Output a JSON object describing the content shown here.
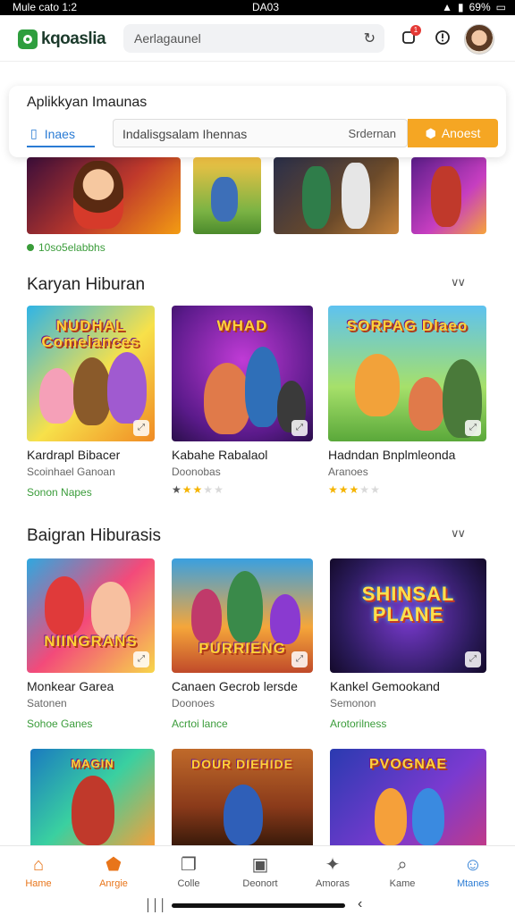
{
  "status_bar": {
    "left": "Mule cato  1:2",
    "center": "DA03",
    "right": "69%"
  },
  "header": {
    "logo_text": "kqoaslia",
    "search_value": "Aerlagaunel",
    "refresh_icon": "refresh-icon",
    "notification_count": "1",
    "accent": "#2e9e3e"
  },
  "popup": {
    "title": "Aplikkyan Imaunas",
    "tab_label": "Inaes",
    "field_value": "Indalisgsalam Ihennas",
    "field_suffix": "Srdernan",
    "button_label": "Anoest",
    "button_color": "#f5a623"
  },
  "strip": {
    "caption": "10so5elabbhs"
  },
  "sections": [
    {
      "title": "Karyan Hiburan",
      "cards": [
        {
          "art_text": "NUDHAL Comelances",
          "name": "Kardrapl Bibacer",
          "sub": "Scoinhael Ganoan",
          "tag": "Sonon Napes",
          "rating": null
        },
        {
          "art_text": "WHAD",
          "name": "Kabahe Rabalaol",
          "sub": "Doonobas",
          "tag": null,
          "rating": 3
        },
        {
          "art_text": "SORPAG Dlaeo",
          "name": "Hadndan Bnplmleonda",
          "sub": "Aranoes",
          "tag": null,
          "rating": 3
        }
      ]
    },
    {
      "title": "Baigran Hiburasis",
      "cards": [
        {
          "art_text": "NIINGRANS",
          "name": "Monkear Garea",
          "sub": "Satonen",
          "tag": "Sohoe Ganes",
          "rating": null
        },
        {
          "art_text": "PURRIENG",
          "name": "Canaen Gecrob  lersde",
          "sub": "Doonoes",
          "tag": "Acrtoi lance",
          "rating": null
        },
        {
          "art_text": "SHINSAL PLANE",
          "name": "Kankel Gemookand",
          "sub": "Semonon",
          "tag": "Arotorilness",
          "rating": null
        }
      ]
    }
  ],
  "bottom_row_art": [
    {
      "art_text": "MAGIN"
    },
    {
      "art_text": "DOUR DIEHIDE"
    },
    {
      "art_text": "PVOGNAE"
    }
  ],
  "bottom_nav": [
    {
      "label": "Hame",
      "icon": "home-outline-icon"
    },
    {
      "label": "Anrgie",
      "icon": "home-filled-icon"
    },
    {
      "label": "Colle",
      "icon": "cards-icon"
    },
    {
      "label": "Deonort",
      "icon": "bag-icon"
    },
    {
      "label": "Amoras",
      "icon": "gamepad-icon"
    },
    {
      "label": "Kame",
      "icon": "search-icon"
    },
    {
      "label": "Mtanes",
      "icon": "user-icon"
    }
  ]
}
